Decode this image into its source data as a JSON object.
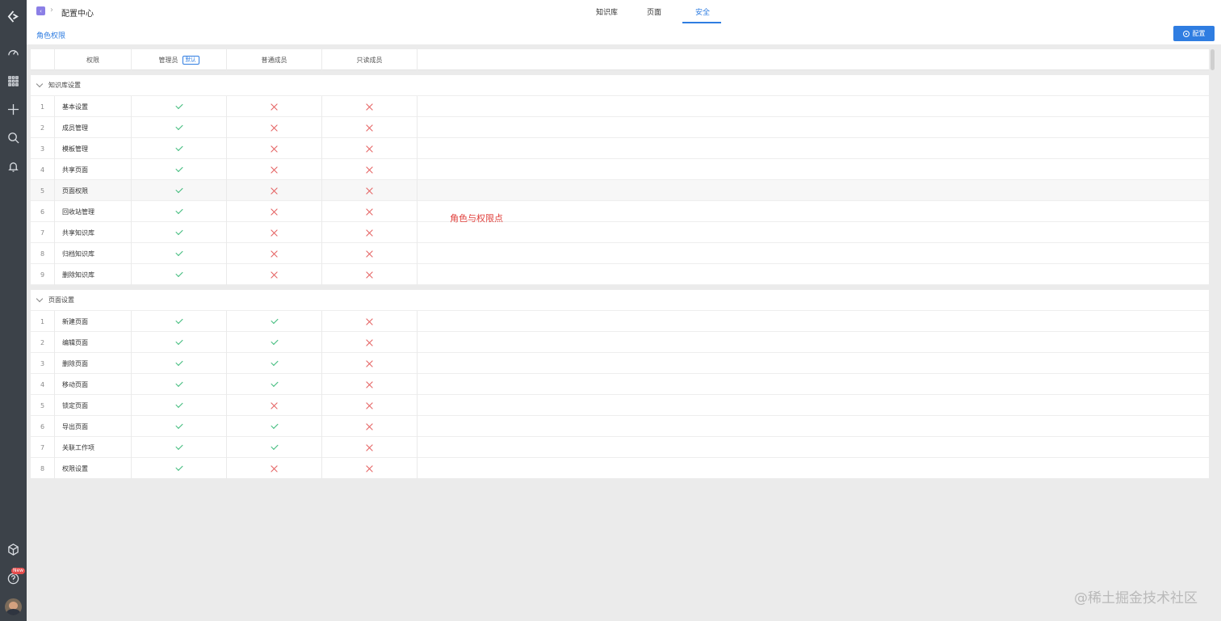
{
  "nav_rail": {
    "icons": [
      "logo-icon",
      "dashboard-icon",
      "apps-grid-icon",
      "plus-icon",
      "search-icon",
      "bell-icon",
      "cube-icon",
      "help-icon",
      "avatar"
    ],
    "new_badge": "New"
  },
  "header": {
    "breadcrumb_title": "配置中心",
    "tabs": [
      {
        "label": "知识库",
        "active": false
      },
      {
        "label": "页面",
        "active": false
      },
      {
        "label": "安全",
        "active": true
      }
    ]
  },
  "subheader": {
    "link": "角色权限",
    "config_button": "配置"
  },
  "table": {
    "columns": [
      "权限",
      "管理员",
      "普通成员",
      "只读成员"
    ],
    "admin_badge": "默认",
    "groups": [
      {
        "title": "知识库设置",
        "rows": [
          {
            "idx": "1",
            "name": "基本设置",
            "perms": [
              true,
              false,
              false
            ]
          },
          {
            "idx": "2",
            "name": "成员管理",
            "perms": [
              true,
              false,
              false
            ]
          },
          {
            "idx": "3",
            "name": "模板管理",
            "perms": [
              true,
              false,
              false
            ]
          },
          {
            "idx": "4",
            "name": "共享页面",
            "perms": [
              true,
              false,
              false
            ]
          },
          {
            "idx": "5",
            "name": "页面权限",
            "perms": [
              true,
              false,
              false
            ]
          },
          {
            "idx": "6",
            "name": "回收站管理",
            "perms": [
              true,
              false,
              false
            ]
          },
          {
            "idx": "7",
            "name": "共享知识库",
            "perms": [
              true,
              false,
              false
            ]
          },
          {
            "idx": "8",
            "name": "归档知识库",
            "perms": [
              true,
              false,
              false
            ]
          },
          {
            "idx": "9",
            "name": "删除知识库",
            "perms": [
              true,
              false,
              false
            ]
          }
        ]
      },
      {
        "title": "页面设置",
        "rows": [
          {
            "idx": "1",
            "name": "新建页面",
            "perms": [
              true,
              true,
              false
            ]
          },
          {
            "idx": "2",
            "name": "编辑页面",
            "perms": [
              true,
              true,
              false
            ]
          },
          {
            "idx": "3",
            "name": "删除页面",
            "perms": [
              true,
              true,
              false
            ]
          },
          {
            "idx": "4",
            "name": "移动页面",
            "perms": [
              true,
              true,
              false
            ]
          },
          {
            "idx": "5",
            "name": "锁定页面",
            "perms": [
              true,
              false,
              false
            ]
          },
          {
            "idx": "6",
            "name": "导出页面",
            "perms": [
              true,
              true,
              false
            ]
          },
          {
            "idx": "7",
            "name": "关联工作项",
            "perms": [
              true,
              true,
              false
            ]
          },
          {
            "idx": "8",
            "name": "权限设置",
            "perms": [
              true,
              false,
              false
            ]
          }
        ]
      }
    ]
  },
  "annotation": "角色与权限点",
  "watermark": "@稀土掘金技术社区"
}
